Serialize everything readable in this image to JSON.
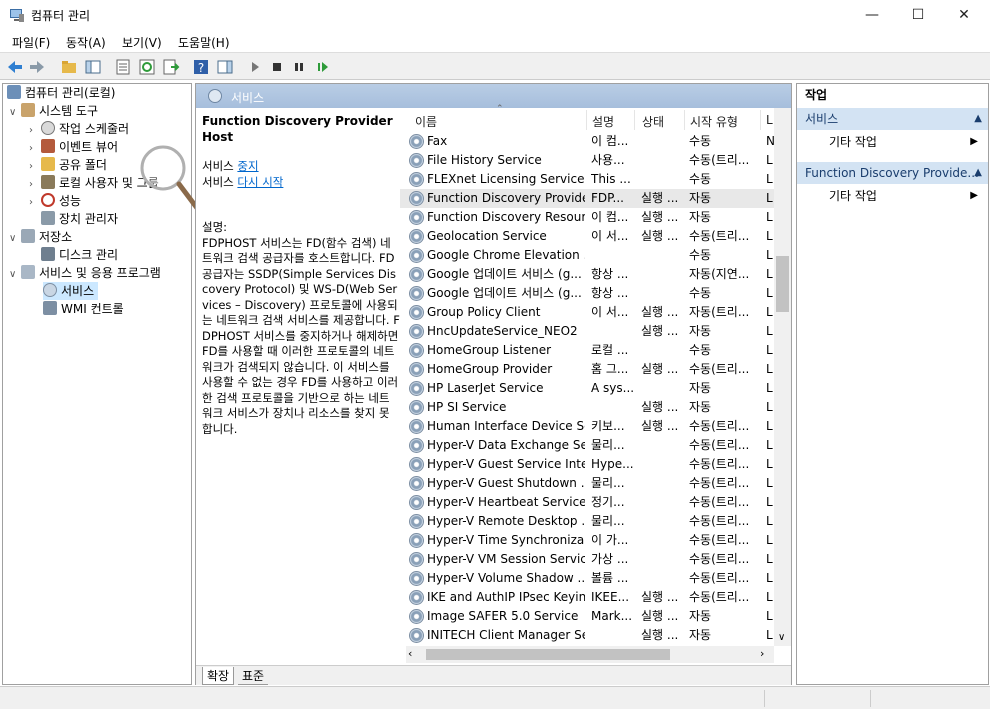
{
  "window": {
    "title": "컴퓨터 관리"
  },
  "menu": [
    "파일(F)",
    "동작(A)",
    "보기(V)",
    "도움말(H)"
  ],
  "tree": {
    "root": "컴퓨터 관리(로컬)",
    "system_tools": "시스템 도구",
    "task_scheduler": "작업 스케줄러",
    "event_viewer": "이벤트 뷰어",
    "shared_folders": "공유 폴더",
    "local_users": "로컬 사용자 및 그룹",
    "performance": "성능",
    "device_manager": "장치 관리자",
    "storage": "저장소",
    "disk_management": "디스크 관리",
    "services_apps": "서비스 및 응용 프로그램",
    "services": "서비스",
    "wmi": "WMI 컨트롤"
  },
  "main": {
    "header": "서비스",
    "desc_title": "Function Discovery Provider Host",
    "svc1_prefix": "서비스 ",
    "stop_link": "중지",
    "svc2_prefix": "서비스 ",
    "restart_link": "다시 시작",
    "desc_label": "설명:",
    "desc_text": "FDPHOST 서비스는 FD(함수 검색) 네트워크 검색 공급자를 호스트합니다. FD 공급자는 SSDP(Simple Services Discovery Protocol) 및 WS-D(Web Services – Discovery) 프로토콜에 사용되는 네트워크 검색 서비스를 제공합니다. FDPHOST 서비스를 중지하거나 해제하면 FD를 사용할 때 이러한 프로토콜의 네트워크가 검색되지 않습니다. 이 서비스를 사용할 수 없는 경우 FD를 사용하고 이러한 검색 프로토콜을 기반으로 하는 네트워크 서비스가 장치나 리소스를 찾지 못합니다."
  },
  "table": {
    "columns": [
      "이름",
      "설명",
      "상태",
      "시작 유형",
      "L"
    ],
    "rows": [
      {
        "name": "Fax",
        "desc": "이 컴...",
        "status": "",
        "startup": "수동",
        "logon": "N"
      },
      {
        "name": "File History Service",
        "desc": "사용...",
        "status": "",
        "startup": "수동(트리...",
        "logon": "L"
      },
      {
        "name": "FLEXnet Licensing Service",
        "desc": "This ...",
        "status": "",
        "startup": "수동",
        "logon": "L"
      },
      {
        "name": "Function Discovery Provide...",
        "desc": "FDP...",
        "status": "실행 ...",
        "startup": "자동",
        "logon": "L"
      },
      {
        "name": "Function Discovery Resour...",
        "desc": "이 컴...",
        "status": "실행 ...",
        "startup": "자동",
        "logon": "L"
      },
      {
        "name": "Geolocation Service",
        "desc": "이 서...",
        "status": "실행 ...",
        "startup": "수동(트리...",
        "logon": "L"
      },
      {
        "name": "Google Chrome Elevation ...",
        "desc": "",
        "status": "",
        "startup": "수동",
        "logon": "L"
      },
      {
        "name": "Google 업데이트 서비스 (g...",
        "desc": "항상 ...",
        "status": "",
        "startup": "자동(지연...",
        "logon": "L"
      },
      {
        "name": "Google 업데이트 서비스 (g...",
        "desc": "항상 ...",
        "status": "",
        "startup": "수동",
        "logon": "L"
      },
      {
        "name": "Group Policy Client",
        "desc": "이 서...",
        "status": "실행 ...",
        "startup": "자동(트리...",
        "logon": "L"
      },
      {
        "name": "HncUpdateService_NEO2",
        "desc": "",
        "status": "실행 ...",
        "startup": "자동",
        "logon": "L"
      },
      {
        "name": "HomeGroup Listener",
        "desc": "로컬 ...",
        "status": "",
        "startup": "수동",
        "logon": "L"
      },
      {
        "name": "HomeGroup Provider",
        "desc": "홈 그...",
        "status": "실행 ...",
        "startup": "수동(트리...",
        "logon": "L"
      },
      {
        "name": "HP LaserJet Service",
        "desc": "A sys...",
        "status": "",
        "startup": "자동",
        "logon": "L"
      },
      {
        "name": "HP SI Service",
        "desc": "",
        "status": "실행 ...",
        "startup": "자동",
        "logon": "L"
      },
      {
        "name": "Human Interface Device Se...",
        "desc": "키보...",
        "status": "실행 ...",
        "startup": "수동(트리...",
        "logon": "L"
      },
      {
        "name": "Hyper-V Data Exchange Se...",
        "desc": "물리...",
        "status": "",
        "startup": "수동(트리...",
        "logon": "L"
      },
      {
        "name": "Hyper-V Guest Service Inte...",
        "desc": "Hype...",
        "status": "",
        "startup": "수동(트리...",
        "logon": "L"
      },
      {
        "name": "Hyper-V Guest Shutdown ...",
        "desc": "물리...",
        "status": "",
        "startup": "수동(트리...",
        "logon": "L"
      },
      {
        "name": "Hyper-V Heartbeat Service",
        "desc": "정기...",
        "status": "",
        "startup": "수동(트리...",
        "logon": "L"
      },
      {
        "name": "Hyper-V Remote Desktop ...",
        "desc": "물리...",
        "status": "",
        "startup": "수동(트리...",
        "logon": "L"
      },
      {
        "name": "Hyper-V Time Synchroniza...",
        "desc": "이 가...",
        "status": "",
        "startup": "수동(트리...",
        "logon": "L"
      },
      {
        "name": "Hyper-V VM Session Service",
        "desc": "가상 ...",
        "status": "",
        "startup": "수동(트리...",
        "logon": "L"
      },
      {
        "name": "Hyper-V Volume Shadow ...",
        "desc": "볼륨 ...",
        "status": "",
        "startup": "수동(트리...",
        "logon": "L"
      },
      {
        "name": "IKE and AuthIP IPsec Keyin...",
        "desc": "IKEE...",
        "status": "실행 ...",
        "startup": "수동(트리...",
        "logon": "L"
      },
      {
        "name": "Image SAFER 5.0 Service",
        "desc": "Mark...",
        "status": "실행 ...",
        "startup": "자동",
        "logon": "L"
      },
      {
        "name": "INITECH Client Manager Se...",
        "desc": "",
        "status": "실행 ...",
        "startup": "자동",
        "logon": "L"
      }
    ]
  },
  "tabs": {
    "extended": "확장",
    "standard": "표준"
  },
  "actions": {
    "title": "작업",
    "section1": "서비스",
    "more1": "기타 작업",
    "section2": "Function Discovery Provide...",
    "more2": "기타 작업"
  }
}
